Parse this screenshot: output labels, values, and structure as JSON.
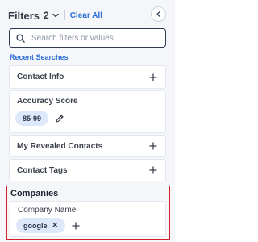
{
  "header": {
    "title": "Filters",
    "count": "2",
    "clear_all": "Clear All"
  },
  "search": {
    "placeholder": "Search filters or values"
  },
  "recent_searches": "Recent Searches",
  "sections": {
    "contact_info": "Contact Info",
    "accuracy_score": {
      "label": "Accuracy Score",
      "chip": "85-99"
    },
    "revealed_contacts": "My Revealed Contacts",
    "contact_tags": "Contact Tags"
  },
  "companies": {
    "title": "Companies",
    "company_name": {
      "label": "Company Name",
      "chip": "google"
    }
  },
  "colors": {
    "accent": "#2f6fd6",
    "highlight_border": "#d61f26",
    "chip_bg": "#dde8fa"
  }
}
